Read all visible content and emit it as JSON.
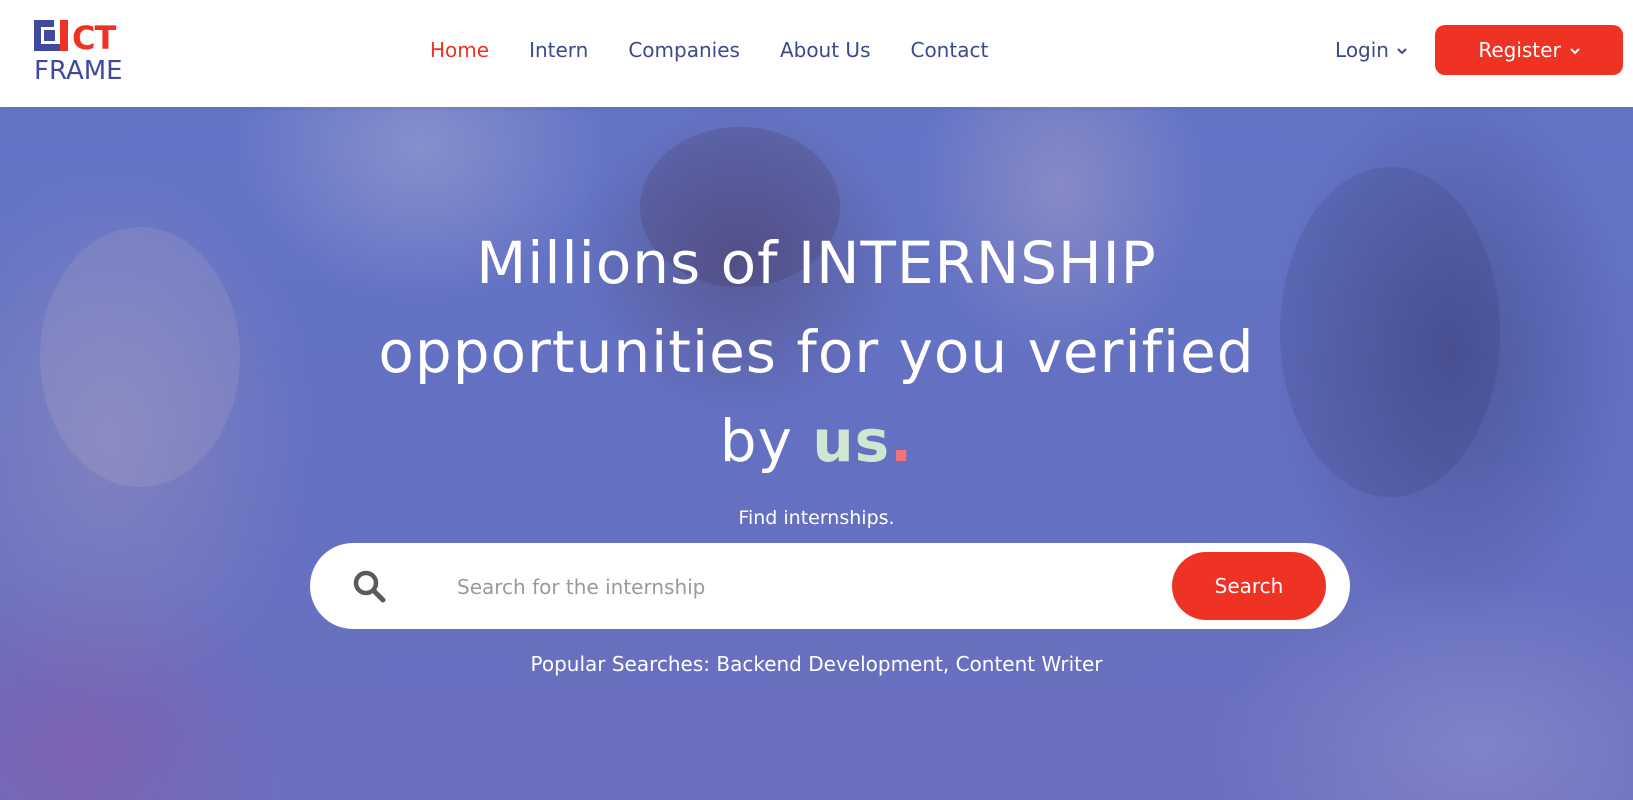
{
  "colors": {
    "brand_blue": "#3f4a9e",
    "brand_red": "#ee3325",
    "nav_text": "#3c4a8c",
    "nav_active": "#ee3325",
    "register_bg": "#ee3325",
    "search_btn_bg": "#ee3325",
    "us_word": "#cfe6d0",
    "us_dot": "#f2727a"
  },
  "logo": {
    "top_text": "CT",
    "bottom_text": "FRAME",
    "icon": "ict-logo-mark"
  },
  "nav": {
    "items": [
      {
        "label": "Home",
        "active": true
      },
      {
        "label": "Intern",
        "active": false
      },
      {
        "label": "Companies",
        "active": false
      },
      {
        "label": "About Us",
        "active": false
      },
      {
        "label": "Contact",
        "active": false
      }
    ],
    "login_label": "Login",
    "register_label": "Register",
    "dropdown_icon": "chevron-down-icon"
  },
  "hero": {
    "headline_line1": "Millions of INTERNSHIP",
    "headline_line2": "opportunities for you verified",
    "headline_line3_prefix": "by ",
    "headline_highlight": "us",
    "headline_dot": ".",
    "subheading": "Find internships.",
    "search": {
      "placeholder": "Search for the internship",
      "value": "",
      "button_label": "Search",
      "icon": "search-icon"
    },
    "popular_searches": "Popular Searches: Backend Development, Content Writer"
  }
}
